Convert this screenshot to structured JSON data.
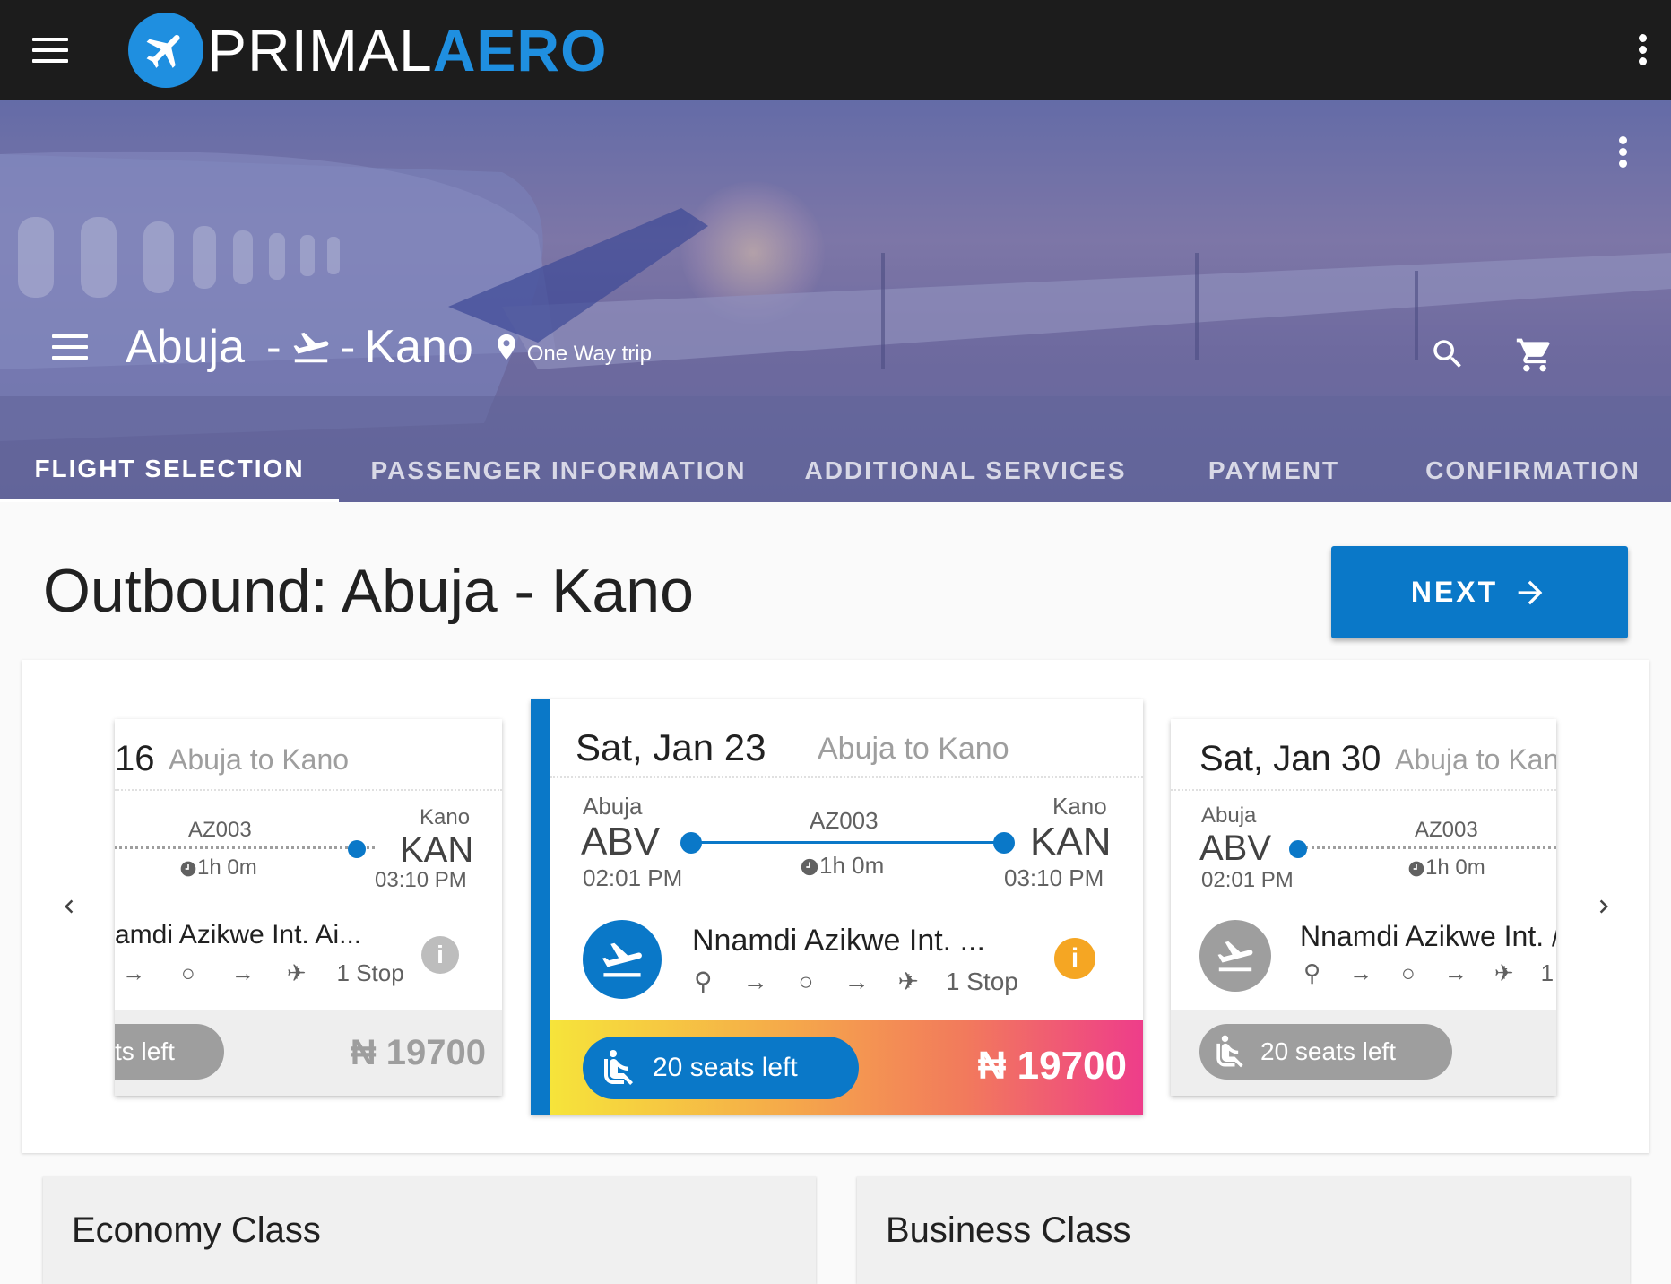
{
  "app": {
    "logo_text_light": "PRIMAL",
    "logo_text_bold": "AERO"
  },
  "hero": {
    "origin": "Abuja",
    "sep1": "-",
    "sep2": "-",
    "destination": "Kano",
    "trip_type": "One Way trip"
  },
  "tabs": [
    {
      "label": "FLIGHT SELECTION",
      "active": true
    },
    {
      "label": "PASSENGER INFORMATION",
      "active": false
    },
    {
      "label": "ADDITIONAL SERVICES",
      "active": false
    },
    {
      "label": "PAYMENT",
      "active": false
    },
    {
      "label": "CONFIRMATION",
      "active": false
    }
  ],
  "main": {
    "title": "Outbound: Abuja - Kano",
    "next_label": "NEXT"
  },
  "cards": {
    "left": {
      "date": "16",
      "route": "Abuja to Kano",
      "flight": "AZ003",
      "duration": "1h 0m",
      "to_city": "Kano",
      "to_code": "KAN",
      "arr_time": "03:10 PM",
      "airport": "amdi Azikwe Int. Ai...",
      "stops": "1 Stop",
      "seats": "ts left",
      "price": "₦ 19700"
    },
    "center": {
      "date": "Sat, Jan 23",
      "route": "Abuja to Kano",
      "from_city": "Abuja",
      "from_code": "ABV",
      "dep_time": "02:01 PM",
      "flight": "AZ003",
      "duration": "1h 0m",
      "to_city": "Kano",
      "to_code": "KAN",
      "arr_time": "03:10 PM",
      "airport": "Nnamdi Azikwe Int. ...",
      "stops": "1 Stop",
      "seats": "20 seats left",
      "price": "₦ 19700"
    },
    "right": {
      "date": "Sat, Jan 30",
      "route": "Abuja to Kan",
      "from_city": "Abuja",
      "from_code": "ABV",
      "dep_time": "02:01 PM",
      "flight": "AZ003",
      "duration": "1h 0m",
      "airport": "Nnamdi Azikwe Int. /",
      "stops": "1 :",
      "seats": "20 seats left"
    }
  },
  "classes": {
    "economy": "Economy Class",
    "business": "Business Class"
  },
  "colors": {
    "primary": "#0a78c8",
    "appbar": "#1c1c1c",
    "accent_orange": "#f5a623"
  }
}
